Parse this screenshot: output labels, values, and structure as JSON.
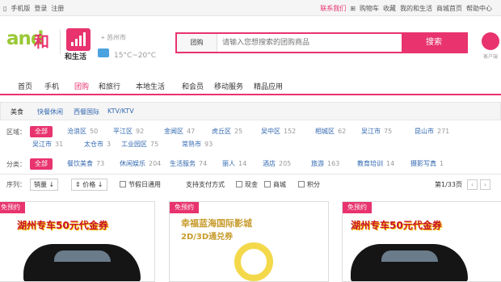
{
  "topbar": {
    "left": [
      "手机版",
      "登录",
      "注册"
    ],
    "right": [
      "联系我们",
      "购物车",
      "收藏",
      "我的和生活",
      "商城首页",
      "帮助中心"
    ]
  },
  "header": {
    "logo_text": "and",
    "logo_he": "和",
    "logo_sub": "和生活",
    "location": "苏州市",
    "temperature": "15°C~20°C",
    "search_category": "团购",
    "search_placeholder": "请输入您想搜索的团购商品",
    "search_button": "搜索",
    "service_label": "客户端"
  },
  "nav": [
    "首页",
    "手机",
    "团购",
    "和旅行",
    "本地生活",
    "和会员",
    "移动服务",
    "精品应用"
  ],
  "category_tabs": [
    "美食",
    "快餐休闲",
    "西餐国际",
    "KTV/KTV"
  ],
  "filters": {
    "region": {
      "label": "区域：",
      "all": "全部",
      "items": [
        {
          "name": "沧浪区",
          "count": "50"
        },
        {
          "name": "平江区",
          "count": "92"
        },
        {
          "name": "金阊区",
          "count": "47"
        },
        {
          "name": "虎丘区",
          "count": "25"
        },
        {
          "name": "吴中区",
          "count": "152"
        },
        {
          "name": "相城区",
          "count": "62"
        },
        {
          "name": "吴江市",
          "count": "75"
        },
        {
          "name": "昆山市",
          "count": "271"
        },
        {
          "name": "吴江市",
          "count": "31"
        },
        {
          "name": "太仓市",
          "count": "3"
        },
        {
          "name": "工业园区",
          "count": "75"
        },
        {
          "name": "常熟市",
          "count": "93"
        }
      ]
    },
    "category": {
      "label": "分类：",
      "all": "全部",
      "items": [
        {
          "name": "餐饮美食",
          "count": "73"
        },
        {
          "name": "休闲娱乐",
          "count": "204"
        },
        {
          "name": "生活服务",
          "count": "74"
        },
        {
          "name": "丽人",
          "count": "14"
        },
        {
          "name": "酒店",
          "count": "205"
        },
        {
          "name": "旅游",
          "count": "163"
        },
        {
          "name": "教育培训",
          "count": "14"
        },
        {
          "name": "摄影写真",
          "count": "1"
        }
      ]
    }
  },
  "sort": {
    "label": "序列：",
    "options": [
      "销量",
      "价格"
    ],
    "checks": [
      "节假日通用",
      "支持支付方式",
      "现金",
      "商城",
      "积分"
    ],
    "page": "第1/33页"
  },
  "cards": [
    {
      "tag": "免预约",
      "banner": "湖州专车50元代金券"
    },
    {
      "tag": "免预约",
      "banner": "幸福蓝海国际影城",
      "banner2": "2D/3D通兑券"
    },
    {
      "tag": "免预约",
      "banner": "湖州专车50元代金券"
    }
  ],
  "colors": {
    "accent": "#e8336e",
    "link": "#3268b0"
  }
}
